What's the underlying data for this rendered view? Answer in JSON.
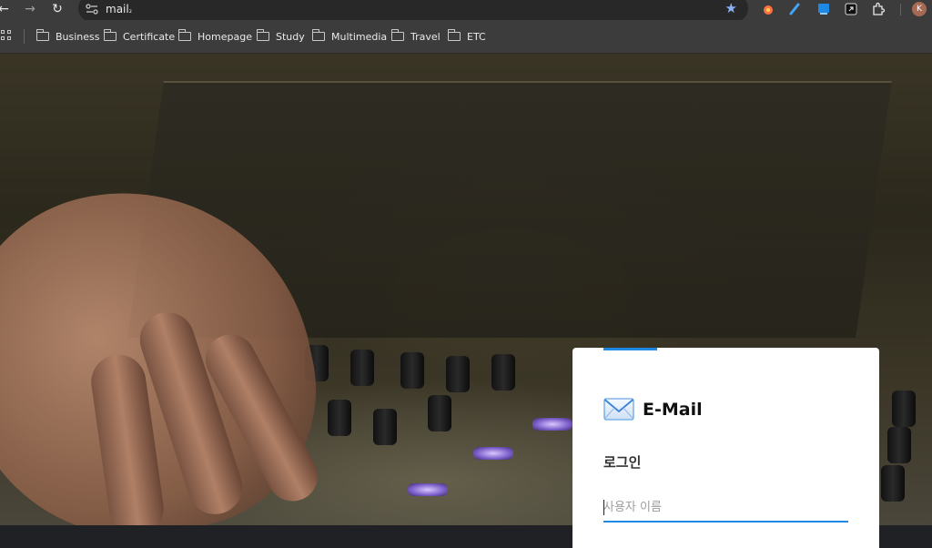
{
  "browser": {
    "url": "mail",
    "url_suffix": "₂",
    "nav": {
      "back_icon": "←",
      "forward_icon": "→",
      "reload_icon": "↻"
    },
    "bookmark_star": "★",
    "avatar_letter": "K",
    "bookmarks": [
      {
        "label": "Business"
      },
      {
        "label": "Certificate"
      },
      {
        "label": "Homepage"
      },
      {
        "label": "Study"
      },
      {
        "label": "Multimedia"
      },
      {
        "label": "Travel"
      },
      {
        "label": "ETC"
      }
    ]
  },
  "login": {
    "brand": "E-Mail",
    "title": "로그인",
    "username_placeholder": "사용자 이름",
    "accent_color": "#1e88e5"
  }
}
